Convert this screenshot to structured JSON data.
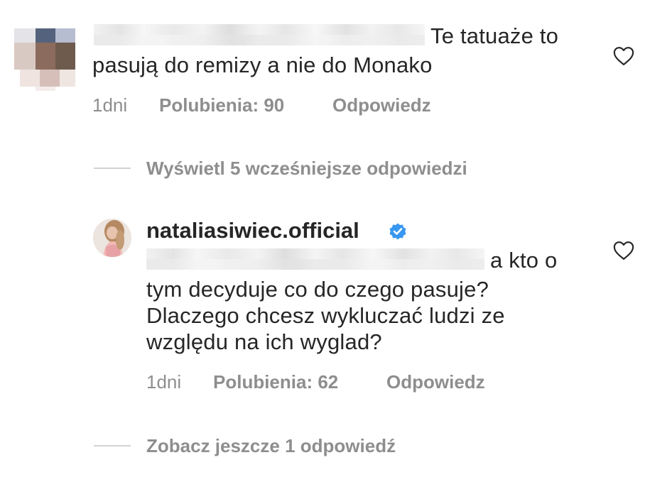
{
  "comment1": {
    "text_line1": "Te tatuaże to",
    "text_line2": "pasują do remizy a nie do Monako",
    "time": "1dni",
    "likes": "Polubienia: 90",
    "reply": "Odpowiedz"
  },
  "view_earlier": "Wyświetl 5 wcześniejsze odpowiedzi",
  "comment2": {
    "username": "nataliasiwiec.official",
    "text_line1": "a kto o",
    "text_line2": "tym decyduje co do czego pasuje?",
    "text_line3": "Dlaczego chcesz wykluczać ludzi ze",
    "text_line4": "względu na ich wyglad?",
    "time": "1dni",
    "likes": "Polubienia: 62",
    "reply": "Odpowiedz"
  },
  "see_more": "Zobacz jeszcze 1 odpowiedź",
  "colors": {
    "text": "#262626",
    "secondary": "#8e8e8e",
    "verified": "#3897f0",
    "divider": "#d2d2d2"
  },
  "icons": {
    "like": "heart-outline-icon",
    "verified": "verified-badge-icon"
  }
}
